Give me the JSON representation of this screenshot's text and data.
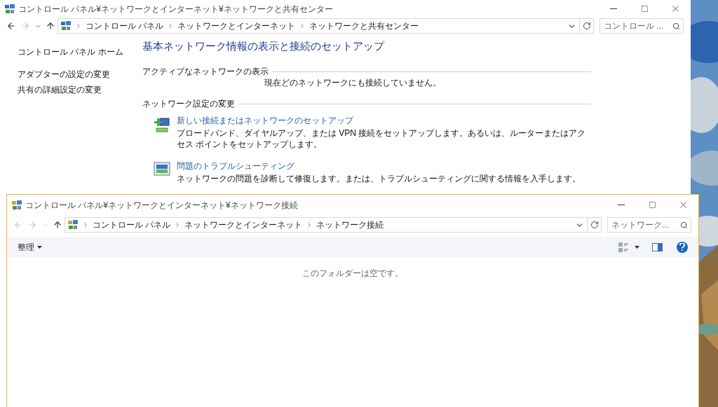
{
  "windows": [
    {
      "title": "コントロール パネル¥ネットワークとインターネット¥ネットワークと共有センター",
      "back_disabled": false,
      "forward_disabled": true,
      "breadcrumb": [
        "コントロール パネル",
        "ネットワークとインターネット",
        "ネットワークと共有センター"
      ],
      "search": {
        "placeholder": "コントロール ..."
      },
      "sidebar": {
        "items": [
          "コントロール パネル ホーム",
          "アダプターの設定の変更",
          "共有の詳細設定の変更"
        ]
      },
      "heading": "基本ネットワーク情報の表示と接続のセットアップ",
      "sections": [
        {
          "title": "アクティブなネットワークの表示",
          "message": "現在どのネットワークにも接続していません。"
        },
        {
          "title": "ネットワーク設定の変更",
          "tasks": [
            {
              "kind": "new-connection",
              "link": "新しい接続またはネットワークのセットアップ",
              "description": "ブロードバンド、ダイヤルアップ、または VPN 接続をセットアップします。あるいは、ルーターまたはアクセス ポイントをセットアップします。"
            },
            {
              "kind": "troubleshoot",
              "link": "問題のトラブルシューティング",
              "description": "ネットワークの問題を診断して修復します。または、トラブルシューティングに関する情報を入手します。"
            }
          ]
        }
      ]
    },
    {
      "title": "コントロール パネル¥ネットワークとインターネット¥ネットワーク接続",
      "back_disabled": true,
      "forward_disabled": true,
      "breadcrumb": [
        "コントロール パネル",
        "ネットワークとインターネット",
        "ネットワーク接続"
      ],
      "search": {
        "placeholder": "ネットワーク..."
      },
      "toolbar": {
        "organize": "整理"
      },
      "empty_message": "このフォルダーは空です。"
    }
  ]
}
